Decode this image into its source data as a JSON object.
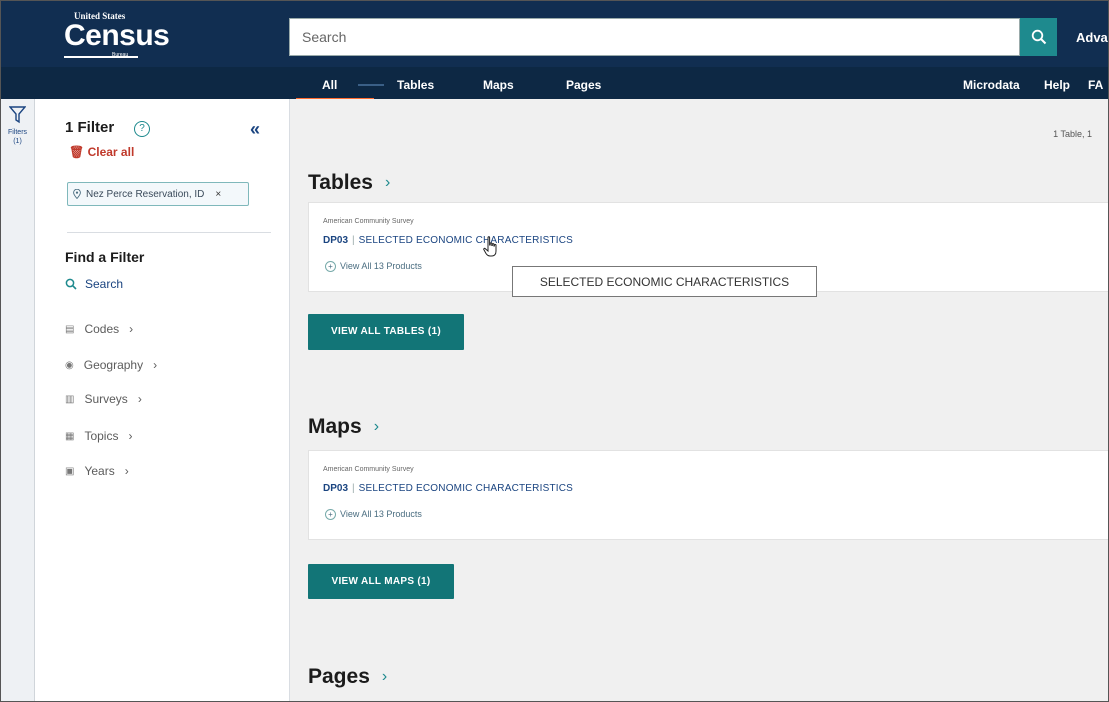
{
  "header": {
    "logo_top": "United States",
    "logo_word": "Census",
    "logo_bottom": "Bureau",
    "search_placeholder": "Search",
    "advanced_label": "Adva"
  },
  "nav": {
    "tabs": [
      {
        "label": "All",
        "active": true
      },
      {
        "label": "Tables",
        "active": false
      },
      {
        "label": "Maps",
        "active": false
      },
      {
        "label": "Pages",
        "active": false
      }
    ],
    "right_links": [
      "Microdata",
      "Help",
      "FA"
    ]
  },
  "rail": {
    "label": "Filters",
    "count": "(1)"
  },
  "filters": {
    "title": "1 Filter",
    "help_glyph": "?",
    "collapse_glyph": "«",
    "clear_all": "Clear all",
    "chip_label": "Nez Perce Reservation, ID",
    "chip_remove": "×",
    "find_title": "Find a Filter",
    "search_label": "Search",
    "facets": [
      {
        "label": "Codes",
        "icon": "codes-icon"
      },
      {
        "label": "Geography",
        "icon": "location-pin-icon"
      },
      {
        "label": "Surveys",
        "icon": "survey-doc-icon"
      },
      {
        "label": "Topics",
        "icon": "topics-grid-icon"
      },
      {
        "label": "Years",
        "icon": "calendar-icon"
      }
    ]
  },
  "results": {
    "count_text": "1 Table, 1",
    "tables": {
      "heading": "Tables",
      "survey": "American Community Survey",
      "code": "DP03",
      "name": "SELECTED ECONOMIC CHARACTERISTICS",
      "view_all_products": "View All 13 Products",
      "button": "VIEW ALL TABLES (1)"
    },
    "maps": {
      "heading": "Maps",
      "survey": "American Community Survey",
      "code": "DP03",
      "name": "SELECTED ECONOMIC CHARACTERISTICS",
      "view_all_products": "View All 13 Products",
      "button": "VIEW ALL MAPS (1)"
    },
    "pages": {
      "heading": "Pages"
    }
  },
  "tooltip": {
    "text": "SELECTED ECONOMIC CHARACTERISTICS"
  },
  "colors": {
    "header_bg": "#112e51",
    "nav_bg": "#0d2844",
    "accent_teal": "#127577",
    "tab_underline": "#ff6c30",
    "clear_red": "#c0392b"
  }
}
